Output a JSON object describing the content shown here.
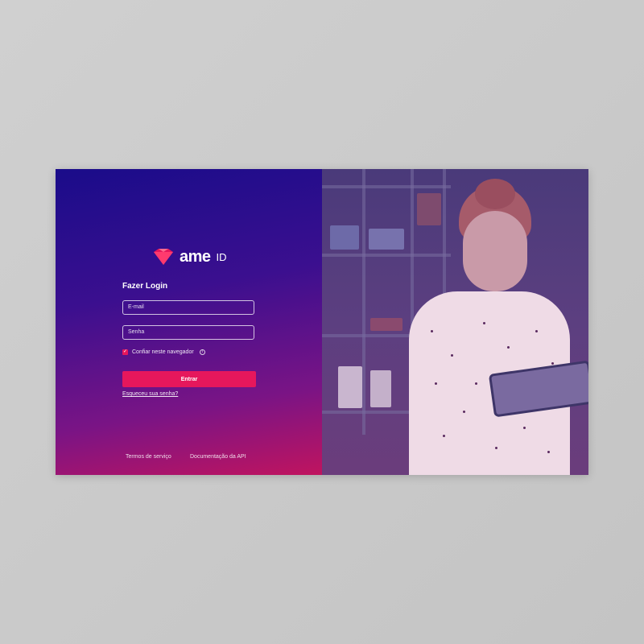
{
  "brand": {
    "name": "ame",
    "suffix": "ID",
    "accent_color": "#e6175c",
    "icon": "diamond-logo-icon"
  },
  "login": {
    "title": "Fazer Login",
    "email_placeholder": "E-mail",
    "password_placeholder": "Senha",
    "trust_label": "Confiar neste navegador",
    "trust_checked": true,
    "submit_label": "Entrar",
    "forgot_label": "Esqueceu sua senha?"
  },
  "footer": {
    "terms_label": "Termos de serviço",
    "docs_label": "Documentação da API"
  },
  "colors": {
    "gradient_top": "#1a0c8a",
    "gradient_bottom": "#c0145f",
    "page_background": "#c9c9c9"
  }
}
